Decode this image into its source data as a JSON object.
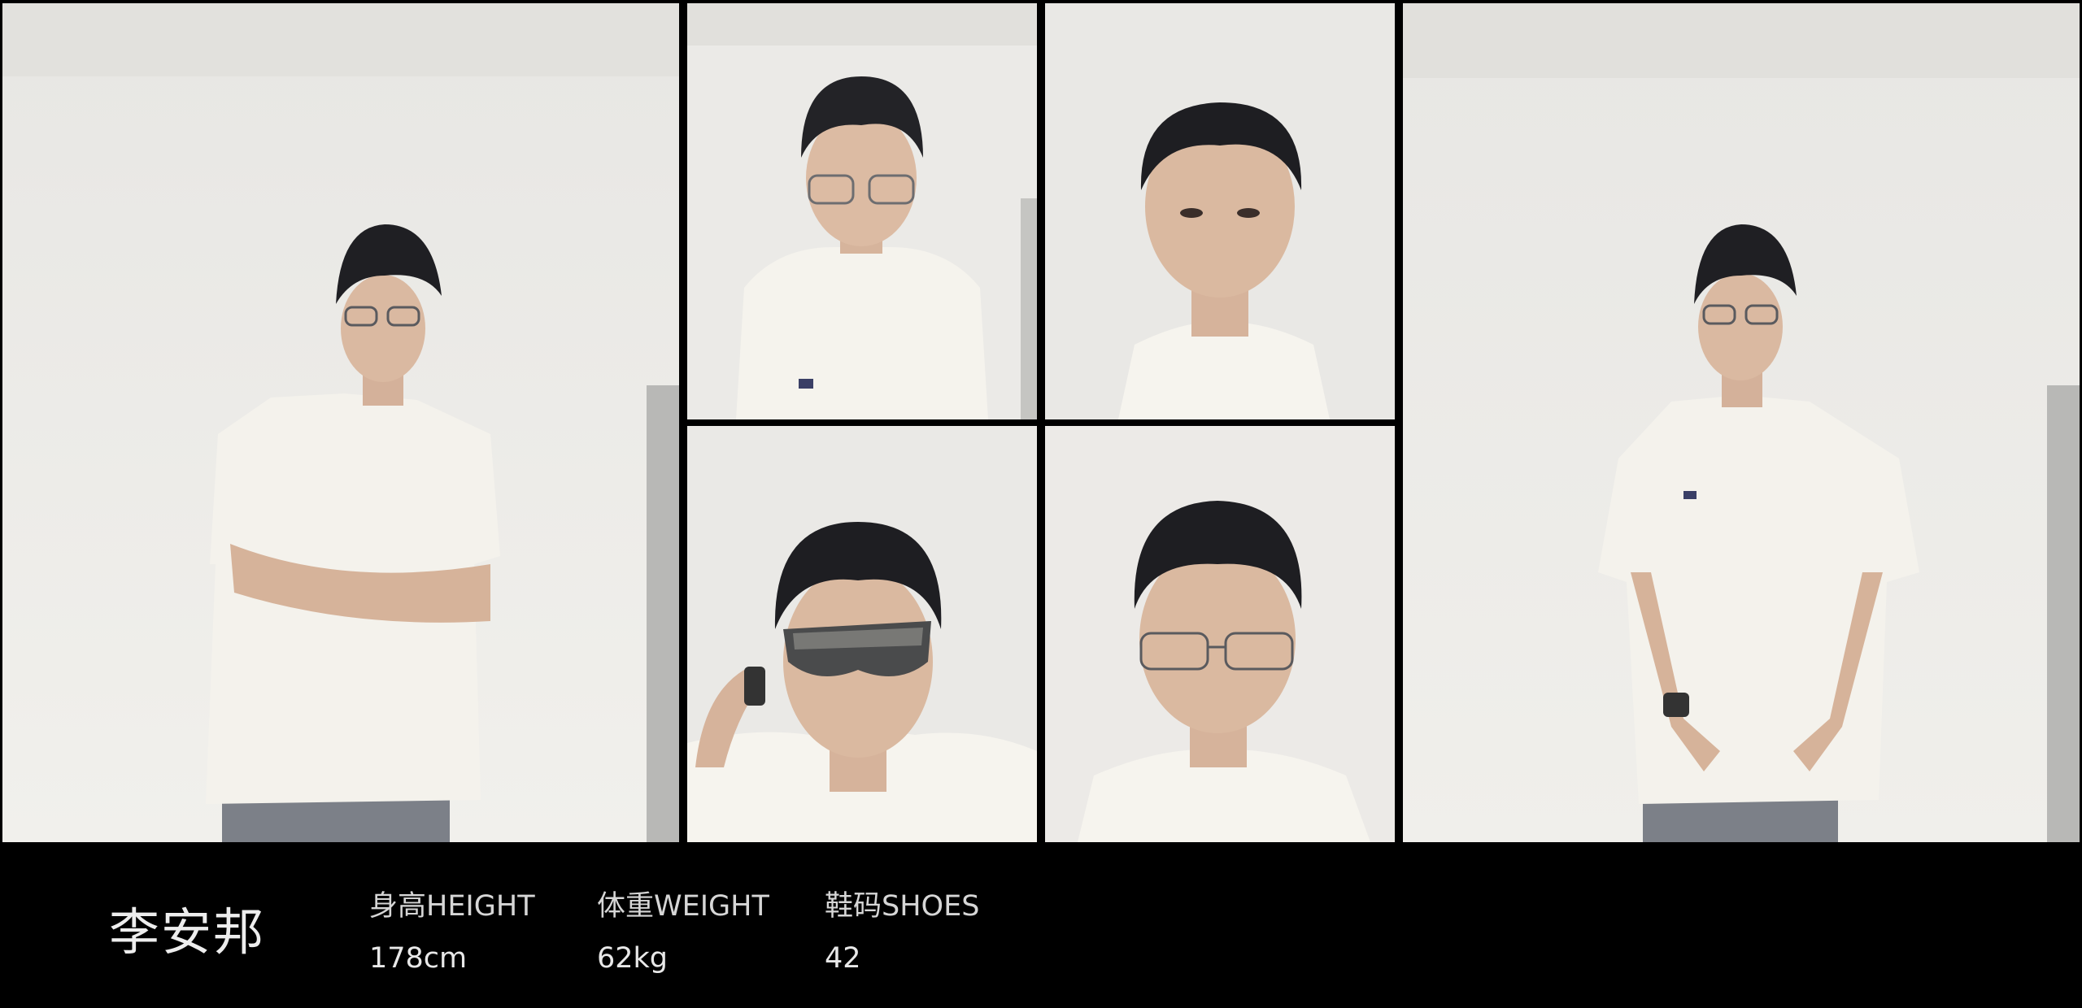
{
  "profile": {
    "name": "李安邦",
    "stats": [
      {
        "label": "身高HEIGHT",
        "value": "178cm"
      },
      {
        "label": "体重WEIGHT",
        "value": "62kg"
      },
      {
        "label": "鞋码SHOES",
        "value": "42"
      }
    ]
  },
  "photos": [
    {
      "icon": "full-body-portrait-arms-crossed"
    },
    {
      "icon": "upper-body-portrait-glasses"
    },
    {
      "icon": "headshot-front"
    },
    {
      "icon": "headshot-sunglasses"
    },
    {
      "icon": "headshot-glasses"
    },
    {
      "icon": "full-body-portrait-hands-clasped"
    }
  ],
  "colors": {
    "background": "#000000",
    "wall": "#ecebe8",
    "shirt": "#f3f1ea",
    "hair": "#1e1e22",
    "skin": "#d9b9a0",
    "text": "#e6e6e6"
  }
}
